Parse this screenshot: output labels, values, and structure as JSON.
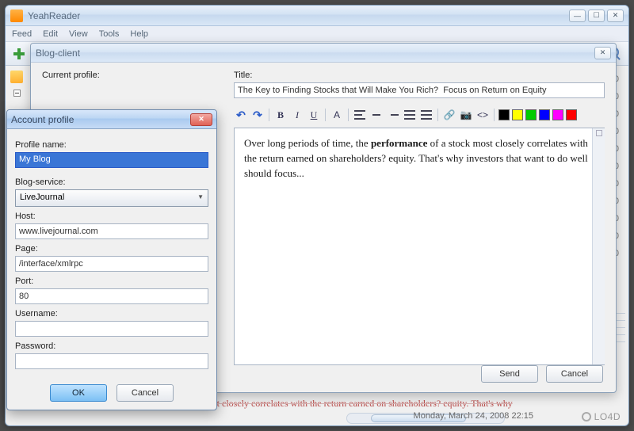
{
  "app": {
    "title": "YeahReader",
    "menus": [
      "Feed",
      "Edit",
      "View",
      "Tools",
      "Help"
    ]
  },
  "right_counts": [
    "0",
    "0",
    "0",
    "0",
    "0",
    "0",
    "0",
    "0",
    "0",
    "0",
    "0"
  ],
  "status_bar": "Monday, March 24, 2008 22:15",
  "watermark": "LO4D                 ",
  "ghost": "a stock most closely correlates with the return earned on shareholders? equity. That's why",
  "blog": {
    "window_title": "Blog-client",
    "profile_label": "Current profile:",
    "title_label": "Title:",
    "title_value": "The Key to Finding Stocks that Will Make You Rich?  Focus on Return on Equity",
    "body_pre": "Over long periods of time, the ",
    "body_bold": "performance",
    "body_post": " of a stock most closely correlates with the return earned on shareholders? equity. That's why investors that want to do well should focus...",
    "send": "Send",
    "cancel": "Cancel",
    "colors": [
      "#000000",
      "#ffff00",
      "#00cc00",
      "#0000ff",
      "#ff00ff",
      "#ff0000"
    ]
  },
  "account": {
    "window_title": "Account profile",
    "profile_name_label": "Profile name:",
    "profile_name_value": "My Blog",
    "service_label": "Blog-service:",
    "service_value": "LiveJournal",
    "host_label": "Host:",
    "host_value": "www.livejournal.com",
    "page_label": "Page:",
    "page_value": "/interface/xmlrpc",
    "port_label": "Port:",
    "port_value": "80",
    "username_label": "Username:",
    "username_value": "",
    "password_label": "Password:",
    "password_value": "",
    "ok": "OK",
    "cancel": "Cancel"
  }
}
